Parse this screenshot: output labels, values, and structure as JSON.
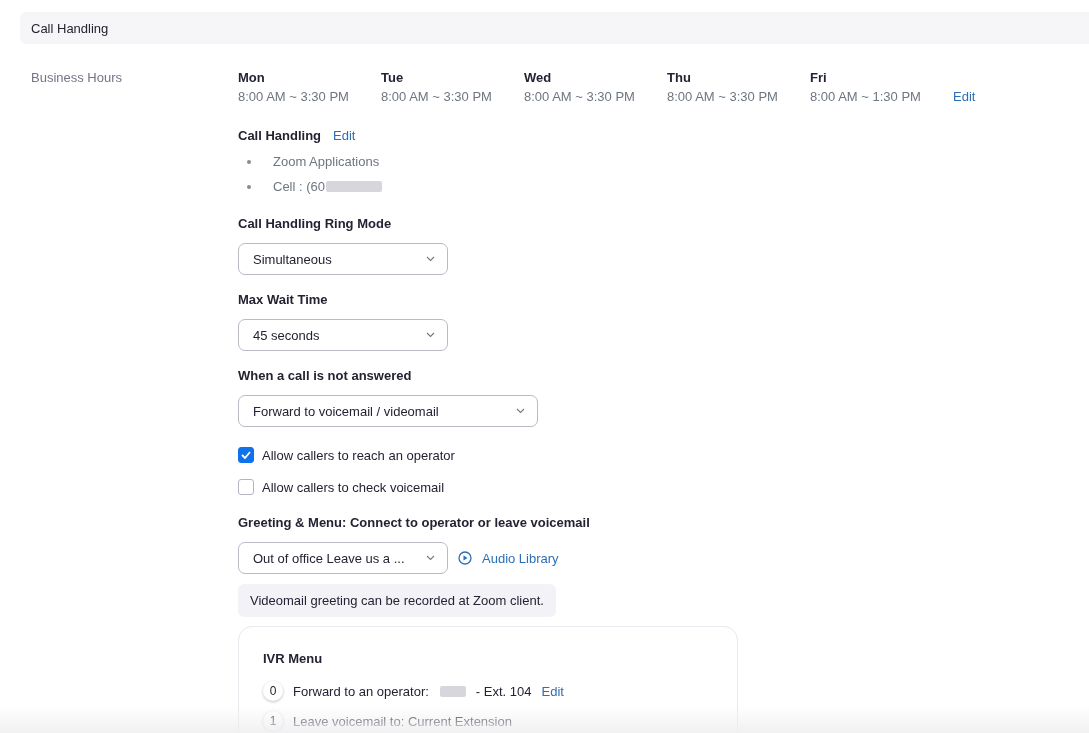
{
  "section_title": "Call Handling",
  "business_hours": {
    "label": "Business Hours",
    "days": [
      {
        "day": "Mon",
        "hours": "8:00 AM ~ 3:30 PM"
      },
      {
        "day": "Tue",
        "hours": "8:00 AM ~ 3:30 PM"
      },
      {
        "day": "Wed",
        "hours": "8:00 AM ~ 3:30 PM"
      },
      {
        "day": "Thu",
        "hours": "8:00 AM ~ 3:30 PM"
      },
      {
        "day": "Fri",
        "hours": "8:00 AM ~ 1:30 PM"
      }
    ],
    "edit": "Edit"
  },
  "call_handling": {
    "title": "Call Handling",
    "edit": "Edit",
    "items": [
      {
        "text": "Zoom Applications",
        "redacted": false
      },
      {
        "text": "Cell : (60",
        "redacted": true
      }
    ]
  },
  "fields": [
    {
      "label": "Call Handling Ring Mode",
      "value": "Simultaneous",
      "wide": false
    },
    {
      "label": "Max Wait Time",
      "value": "45 seconds",
      "wide": false
    },
    {
      "label": "When a call is not answered",
      "value": "Forward to voicemail / videomail",
      "wide": true
    }
  ],
  "checkboxes": [
    {
      "label": "Allow callers to reach an operator",
      "checked": true
    },
    {
      "label": "Allow callers to check voicemail",
      "checked": false
    }
  ],
  "greeting": {
    "label": "Greeting & Menu: Connect to operator or leave voicemail",
    "value": "Out of office Leave us a ...",
    "link": "Audio Library",
    "note": "Videomail greeting can be recorded at Zoom client."
  },
  "ivr": {
    "title": "IVR Menu",
    "items": [
      {
        "key": "0",
        "text": "Forward to an operator:",
        "redacted": true,
        "suffix": "- Ext. 104",
        "edit": "Edit"
      },
      {
        "key": "1",
        "text": "Leave voicemail to: Current Extension",
        "redacted": false
      }
    ]
  }
}
